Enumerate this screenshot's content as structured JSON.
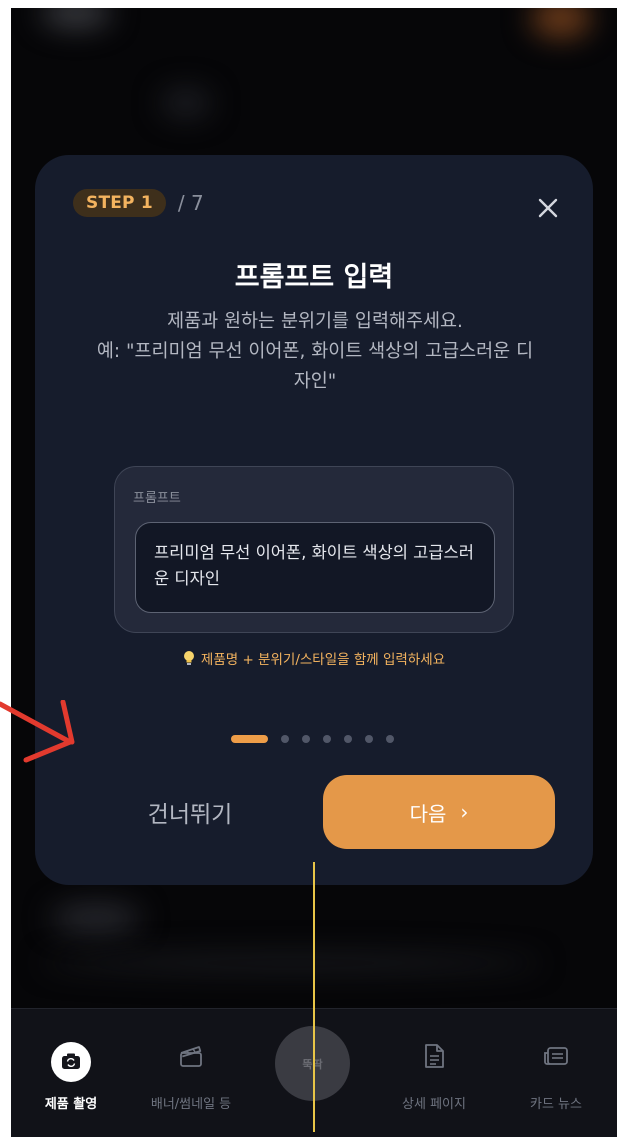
{
  "modal": {
    "step_badge": "STEP 1",
    "step_total": "/ 7",
    "title": "프롬프트 입력",
    "description_line1": "제품과 원하는 분위기를 입력해주세요.",
    "description_line2": "예: \"프리미엄 무선 이어폰, 화이트 색상의 고급스러운 디자인\"",
    "prompt_label": "프롬프트",
    "prompt_value": "프리미엄 무선 이어폰, 화이트 색상의 고급스러운 디자인",
    "tip": "제품명 + 분위기/스타일을 함께 입력하세요",
    "skip_label": "건너뛰기",
    "next_label": "다음",
    "next_chevron": "›",
    "current_step": 1,
    "total_steps": 7
  },
  "bottom_nav": {
    "items": [
      {
        "label": "제품 촬영",
        "icon": "camera-swap-icon",
        "active": true
      },
      {
        "label": "배너/썸네일 등",
        "icon": "clapperboard-icon",
        "active": false
      },
      {
        "label": "뚝딱",
        "icon": "center-action",
        "active": false
      },
      {
        "label": "상세 페이지",
        "icon": "document-icon",
        "active": false
      },
      {
        "label": "카드 뉴스",
        "icon": "news-card-icon",
        "active": false
      }
    ]
  },
  "colors": {
    "accent": "#e49849",
    "modal_bg": "#161c2c",
    "tip": "#f3b35f",
    "annotation_arrow": "#e23a2e",
    "annotation_line": "#e8c547"
  }
}
